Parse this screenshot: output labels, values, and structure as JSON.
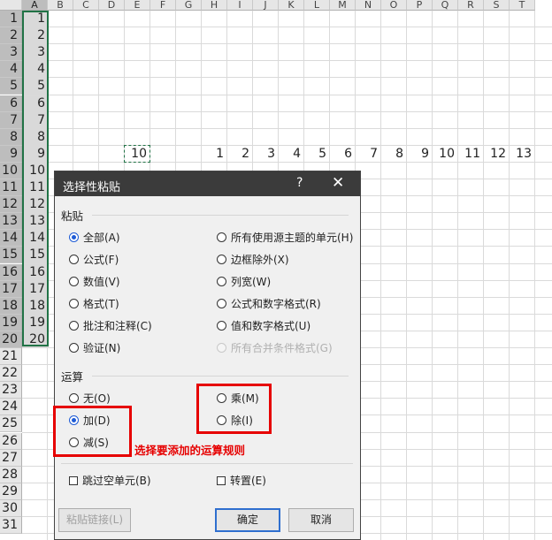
{
  "columns": [
    "A",
    "B",
    "C",
    "D",
    "E",
    "F",
    "G",
    "H",
    "I",
    "J",
    "K",
    "L",
    "M",
    "N",
    "O",
    "P",
    "Q",
    "R",
    "S",
    "T"
  ],
  "rows": [
    "1",
    "2",
    "3",
    "4",
    "5",
    "6",
    "7",
    "8",
    "9",
    "10",
    "11",
    "12",
    "13",
    "14",
    "15",
    "16",
    "17",
    "18",
    "19",
    "20",
    "21",
    "22",
    "23",
    "24",
    "25",
    "26",
    "27",
    "28",
    "29",
    "30",
    "31"
  ],
  "col_a_values": [
    "1",
    "2",
    "3",
    "4",
    "5",
    "6",
    "7",
    "8",
    "9",
    "10",
    "11",
    "12",
    "13",
    "14",
    "15",
    "16",
    "17",
    "18",
    "19",
    "20"
  ],
  "copied_cell": "10",
  "row9_values": [
    "1",
    "2",
    "3",
    "4",
    "5",
    "6",
    "7",
    "8",
    "9",
    "10",
    "11",
    "12",
    "13"
  ],
  "dialog": {
    "title": "选择性粘贴",
    "help": "?",
    "close": "✕",
    "paste_section": "粘贴",
    "paste_left": [
      "全部(A)",
      "公式(F)",
      "数值(V)",
      "格式(T)",
      "批注和注释(C)",
      "验证(N)"
    ],
    "paste_right": [
      "所有使用源主题的单元(H)",
      "边框除外(X)",
      "列宽(W)",
      "公式和数字格式(R)",
      "值和数字格式(U)",
      "所有合并条件格式(G)"
    ],
    "operation_section": "运算",
    "op_none": "无(O)",
    "op_add": "加(D)",
    "op_subtract": "减(S)",
    "op_multiply": "乘(M)",
    "op_divide": "除(I)",
    "skip_blanks": "跳过空单元(B)",
    "transpose": "转置(E)",
    "paste_link": "粘贴链接(L)",
    "ok": "确定",
    "cancel": "取消"
  },
  "annotation": "选择要添加的运算规则",
  "colors": {
    "accent": "#217346",
    "annotation": "#e60000",
    "radio_selected": "#1e5bd6"
  }
}
